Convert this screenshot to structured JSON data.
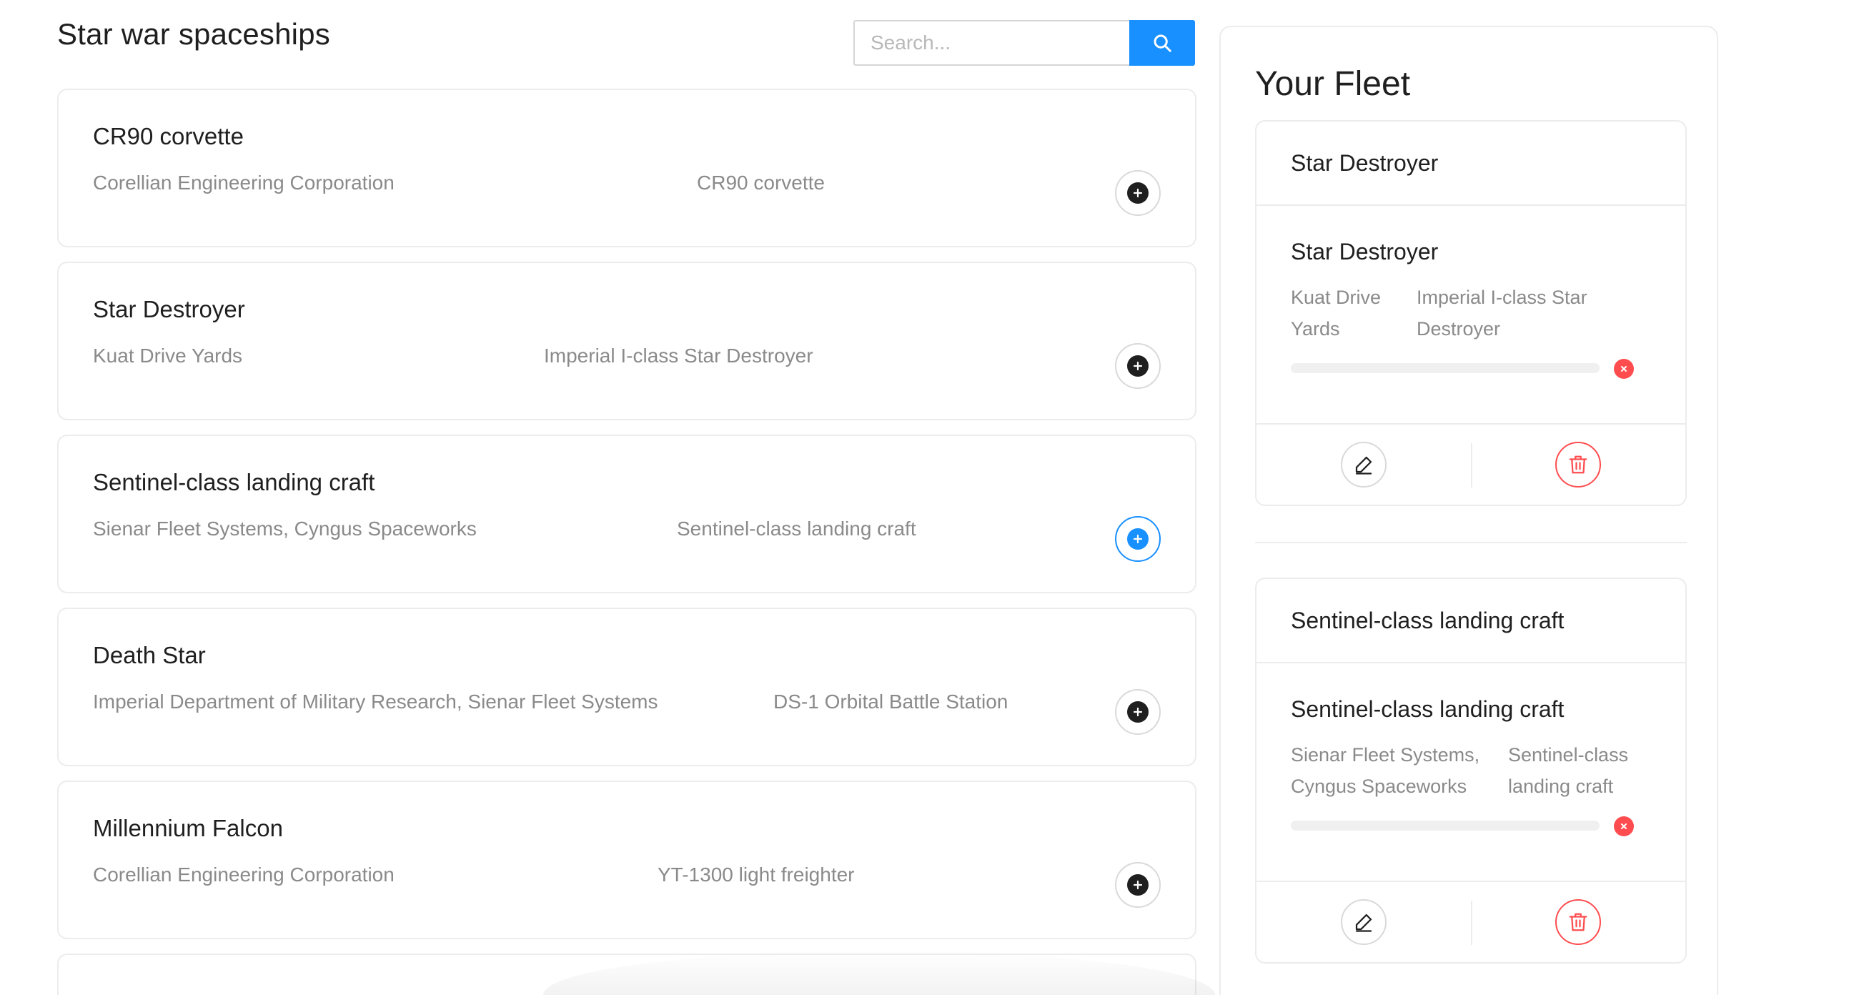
{
  "header": {
    "title": "Star war spaceships",
    "search_placeholder": "Search..."
  },
  "ships": [
    {
      "name": "CR90 corvette",
      "manufacturer": "Corellian Engineering Corporation",
      "model": "CR90 corvette"
    },
    {
      "name": "Star Destroyer",
      "manufacturer": "Kuat Drive Yards",
      "model": "Imperial I-class Star Destroyer"
    },
    {
      "name": "Sentinel-class landing craft",
      "manufacturer": "Sienar Fleet Systems, Cyngus Spaceworks",
      "model": "Sentinel-class landing craft"
    },
    {
      "name": "Death Star",
      "manufacturer": "Imperial Department of Military Research, Sienar Fleet Systems",
      "model": "DS-1 Orbital Battle Station"
    },
    {
      "name": "Millennium Falcon",
      "manufacturer": "Corellian Engineering Corporation",
      "model": "YT-1300 light freighter"
    }
  ],
  "fleet": {
    "title": "Your Fleet",
    "items": [
      {
        "header": "Star Destroyer",
        "name": "Star Destroyer",
        "manufacturer_lines": [
          "Kuat Drive",
          "Yards"
        ],
        "model_lines": [
          "Imperial I-class Star",
          "Destroyer"
        ],
        "progress": 0
      },
      {
        "header": "Sentinel-class landing craft",
        "name": "Sentinel-class landing craft",
        "manufacturer_lines": [
          "Sienar Fleet Systems,",
          "Cyngus Spaceworks"
        ],
        "model_lines": [
          "Sentinel-class",
          "landing craft"
        ],
        "progress": 0
      }
    ]
  },
  "icons": {
    "search": "search-icon",
    "add": "plus-circle-icon",
    "remove": "close-circle-icon",
    "edit": "edit-pencil-icon",
    "delete": "trash-icon"
  },
  "colors": {
    "primary": "#1890ff",
    "danger": "#ff4d4f",
    "text": "#1f1f1f",
    "muted": "#8a8a8a",
    "border": "#ececec"
  }
}
